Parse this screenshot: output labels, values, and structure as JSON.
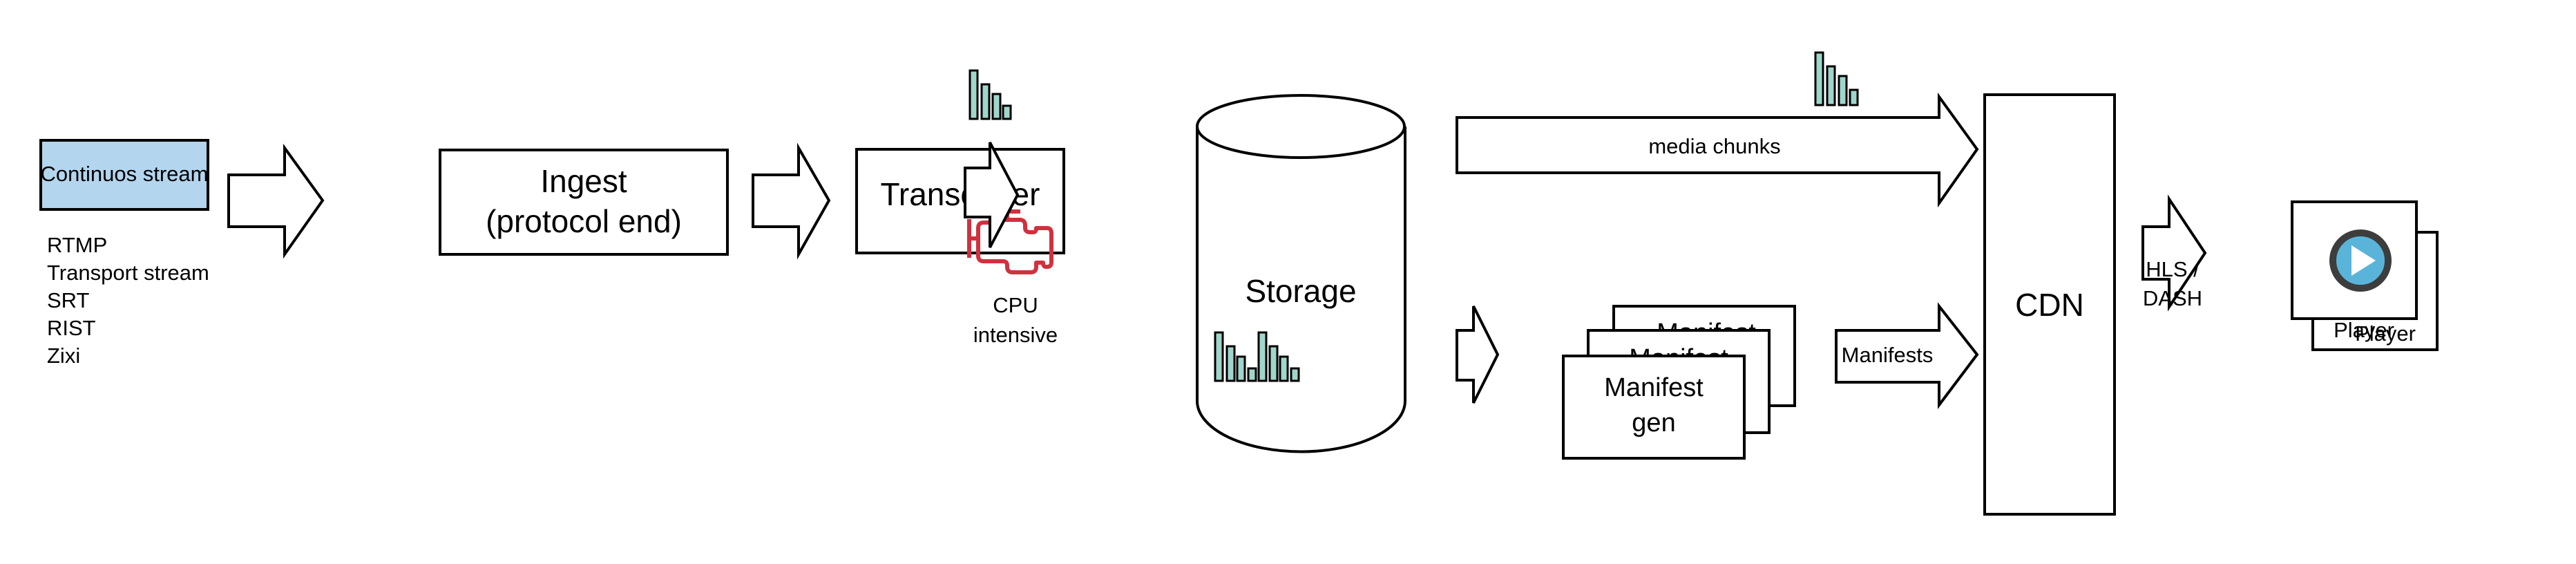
{
  "source": {
    "label": "Continuos stream",
    "fill": "#b3d5ee",
    "protocols": [
      "RTMP",
      "Transport stream",
      "SRT",
      "RIST",
      "Zixi"
    ]
  },
  "ingest": {
    "line1": "Ingest",
    "line2": "(protocol end)"
  },
  "transcoder": {
    "label": "Transcoder",
    "note_line1": "CPU",
    "note_line2": "intensive",
    "icon_color": "#d0313f"
  },
  "storage": {
    "label": "Storage"
  },
  "media_arrow": {
    "label": "media chunks"
  },
  "manifest_gen": {
    "label_line1": "Manifest",
    "label_line2": "gen",
    "back_label": "Manifest"
  },
  "manifests_arrow": {
    "label": "Manifests"
  },
  "cdn": {
    "label": "CDN"
  },
  "delivery_arrow": {
    "line1": "HLS /",
    "line2": "DASH"
  },
  "player": {
    "front_label": "Player",
    "back_label": "Player",
    "icon_ring": "#3d3d3d",
    "icon_fill": "#5ab4da"
  },
  "chunk_color": "#9fd6cc"
}
